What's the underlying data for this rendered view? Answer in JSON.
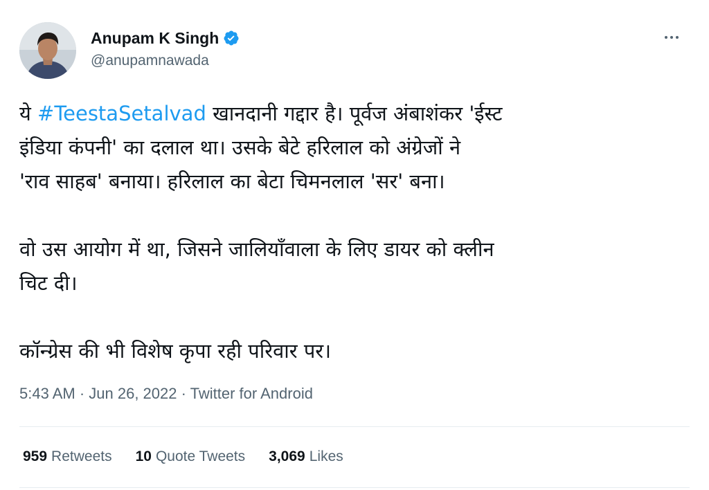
{
  "tweet": {
    "author": {
      "display_name": "Anupam K Singh",
      "handle": "@anupamnawada",
      "verified_color": "#1d9bf0"
    },
    "text": {
      "line1_prefix": "ये ",
      "hashtag": "#TeestaSetalvad",
      "line1_suffix": " खानदानी गद्दार है। पूर्वज अंबाशंकर 'ईस्ट",
      "line2": "इंडिया कंपनी' का दलाल था। उसके बेटे हरिलाल को अंग्रेजों ने",
      "line3": "'राव साहब' बनाया। हरिलाल का बेटा चिमनलाल 'सर' बना।",
      "line4": "वो उस आयोग में था, जिसने जालियाँवाला के लिए डायर को क्लीन",
      "line5": "चिट दी।",
      "line6": "कॉन्ग्रेस की भी विशेष कृपा रही परिवार पर।"
    },
    "meta": "5:43 AM · Jun 26, 2022 · Twitter for Android",
    "stats": {
      "retweets_count": "959",
      "retweets_label": "Retweets",
      "quotes_count": "10",
      "quotes_label": "Quote Tweets",
      "likes_count": "3,069",
      "likes_label": "Likes"
    },
    "icons": {
      "more": "more-dots-icon",
      "verified": "verified-badge-icon"
    }
  }
}
